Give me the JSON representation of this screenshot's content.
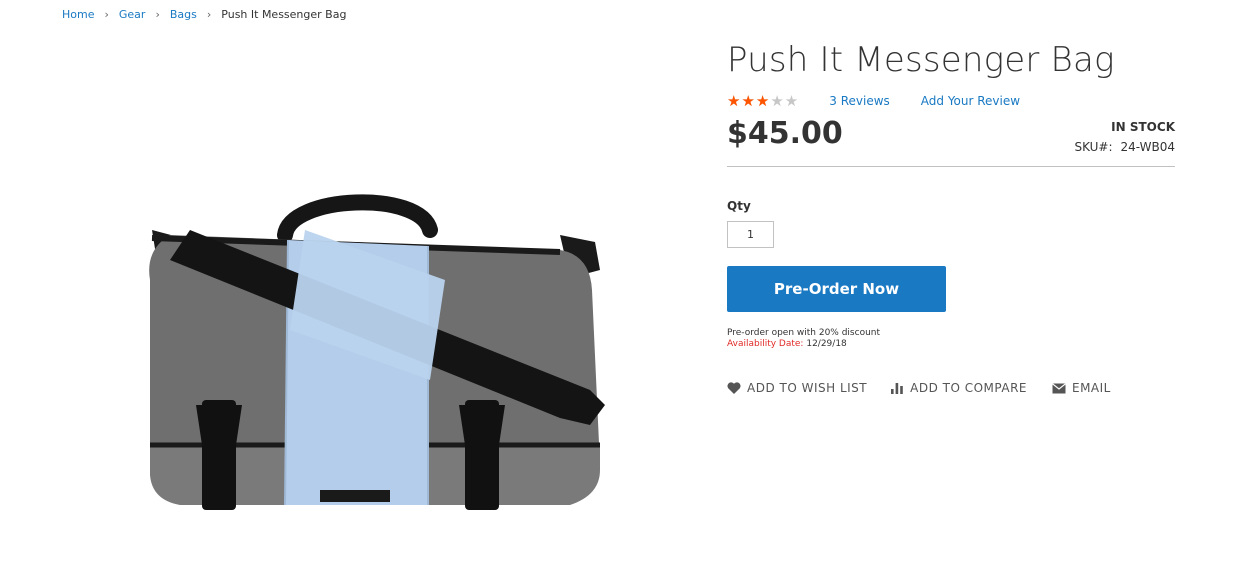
{
  "breadcrumb": {
    "items": [
      "Home",
      "Gear",
      "Bags"
    ],
    "current": "Push It Messenger Bag",
    "separator": "›"
  },
  "product": {
    "title": "Push It Messenger Bag",
    "rating_fraction": 0.6,
    "stars": "★★★★★",
    "reviews_link": "3  Reviews",
    "add_review_link": "Add Your Review",
    "price": "$45.00",
    "stock": "IN STOCK",
    "sku_label": "SKU#:",
    "sku_value": "24-WB04",
    "qty_label": "Qty",
    "qty_value": "1",
    "preorder_button": "Pre-Order Now",
    "preorder_note": "Pre-order open with 20% discount",
    "availability_label": "Availability Date:",
    "availability_date": "12/29/18",
    "actions": {
      "wishlist": "ADD TO WISH LIST",
      "compare": "ADD TO COMPARE",
      "email": "EMAIL"
    }
  },
  "colors": {
    "link": "#1979c3",
    "button": "#1979c3",
    "star": "#ff5501",
    "availability": "#e02b27",
    "bag_gray": "#6f6f6f",
    "bag_blue": "#b3cdea"
  }
}
